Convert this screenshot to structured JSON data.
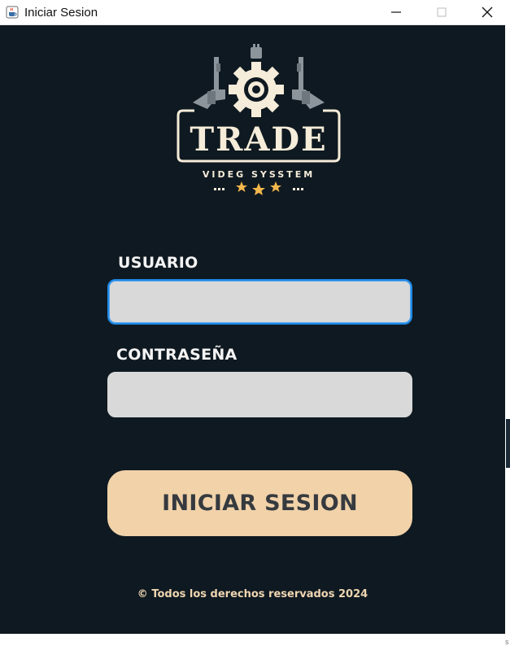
{
  "window": {
    "title": "Iniciar Sesion"
  },
  "logo": {
    "brand": "TRADE",
    "tagline": "VIDEG SYSSTEM"
  },
  "form": {
    "user_label": "USUARIO",
    "user_value": "",
    "password_label": "CONTRASEÑA",
    "password_value": ""
  },
  "login_button": {
    "label": "INICIAR SESION"
  },
  "footer": {
    "text": "© Todos los derechos reservados 2024"
  },
  "colors": {
    "background": "#0f1921",
    "input_bg": "#d9d9d9",
    "focus_border": "#1e88e5",
    "button_bg": "#f1d2a9",
    "button_text": "#363a3f",
    "footer_text": "#efd6b1",
    "logo_cream": "#f5ecd9",
    "star": "#f2b84b"
  },
  "icons": {
    "app": "java-cup-icon",
    "minimize": "minimize-icon",
    "maximize": "maximize-icon",
    "close": "close-icon"
  }
}
